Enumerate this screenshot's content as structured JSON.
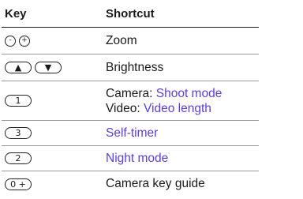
{
  "headers": {
    "key": "Key",
    "shortcut": "Shortcut"
  },
  "rows": [
    {
      "keys": [
        "volume-down-icon",
        "volume-up-icon"
      ],
      "shortcut": "Zoom"
    },
    {
      "keys": [
        "up-arrow-key-icon",
        "down-arrow-key-icon"
      ],
      "shortcut": "Brightness"
    },
    {
      "keys": [
        "1"
      ],
      "line1_label": "Camera: ",
      "line1_link": "Shoot mode",
      "line2_label": "Video: ",
      "line2_link": "Video length"
    },
    {
      "keys": [
        "3"
      ],
      "shortcut_link": "Self-timer"
    },
    {
      "keys": [
        "2"
      ],
      "shortcut_link": "Night mode"
    },
    {
      "keys": [
        "0 +"
      ],
      "shortcut": "Camera key guide"
    }
  ],
  "colors": {
    "link": "#5b3fd8",
    "text": "#1a1a1a",
    "rule": "#9a9a9a"
  }
}
